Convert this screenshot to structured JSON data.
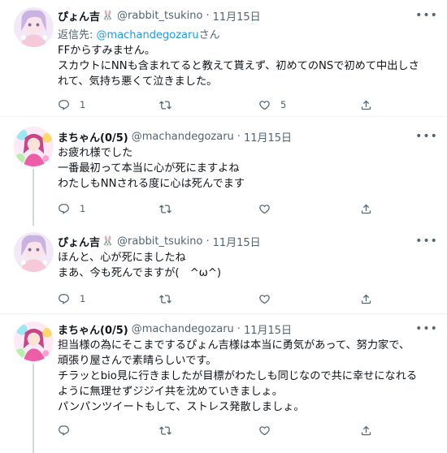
{
  "tweets": [
    {
      "name": "ぴょん吉",
      "emoji": "🐰",
      "handle": "@rabbit_tsukino",
      "dot": "·",
      "date": "11月15日",
      "reply_prefix": "返信先:",
      "reply_mention": "@machandegozaru",
      "reply_suffix": "さん",
      "lines": [
        "FFからすみません。",
        "スカウトにNNも含まれてると教えて貰えず、初めてのNSで初めて中出しさ",
        "れて、気持ち悪くて泣きました。"
      ],
      "reply_count": "1",
      "retweet_count": "",
      "like_count": "5"
    },
    {
      "name": "まちゃん(0/5)",
      "handle": "@machandegozaru",
      "dot": "·",
      "date": "11月15日",
      "lines": [
        "お疲れ様でした",
        "一番最初って本当に心が死にますよね",
        "わたしもNNされる度に心は死んでます"
      ],
      "reply_count": "1",
      "retweet_count": "",
      "like_count": ""
    },
    {
      "name": "ぴょん吉",
      "emoji": "🐰",
      "handle": "@rabbit_tsukino",
      "dot": "·",
      "date": "11月15日",
      "lines": [
        "ほんと、心が死にましたね",
        "まあ、今も死んでますが(　^ω^)"
      ],
      "reply_count": "1",
      "retweet_count": "",
      "like_count": ""
    },
    {
      "name": "まちゃん(0/5)",
      "handle": "@machandegozaru",
      "dot": "·",
      "date": "11月15日",
      "lines": [
        "担当様の為にそこまでするぴょん吉様は本当に勇気があって、努力家で、",
        "頑張り屋さんで素晴らしいです。",
        "チラッとbio見に行きましたが目標がわたしも同じなので共に幸せになれる",
        "ように無理せずジジイ共を沈めていきましょ。",
        "パンパンツイートもして、ストレス発散しましょ。"
      ],
      "reply_count": "",
      "retweet_count": "",
      "like_count": ""
    }
  ],
  "colors": {
    "name": "#0f1419",
    "secondary": "#536471",
    "link": "#1d9bf0",
    "divider": "#eff3f4",
    "thread_line": "#cfd9de"
  },
  "icons": [
    "more-icon",
    "reply-icon",
    "retweet-icon",
    "like-icon",
    "share-icon"
  ]
}
